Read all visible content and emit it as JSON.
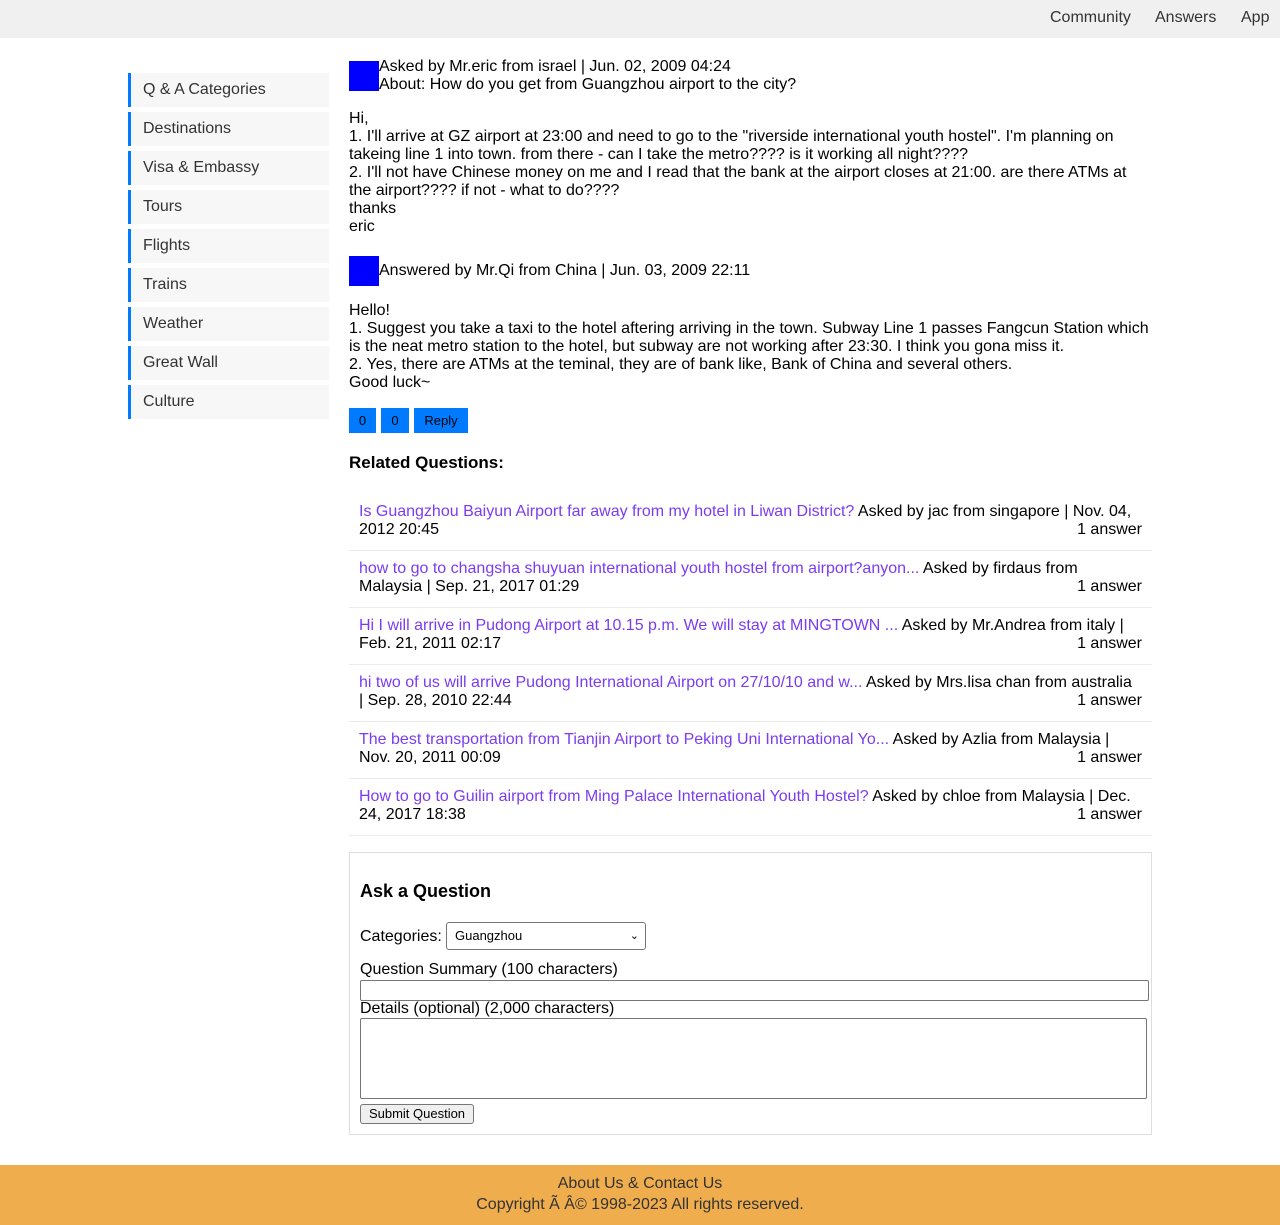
{
  "nav": {
    "community": "Community",
    "answers": "Answers",
    "app": "App"
  },
  "sidebar": {
    "items": [
      {
        "label": "Q & A Categories"
      },
      {
        "label": "Destinations"
      },
      {
        "label": "Visa & Embassy"
      },
      {
        "label": "Tours"
      },
      {
        "label": "Flights"
      },
      {
        "label": "Trains"
      },
      {
        "label": "Weather"
      },
      {
        "label": "Great Wall"
      },
      {
        "label": "Culture"
      }
    ]
  },
  "question": {
    "meta": "Asked by Mr.eric from israel | Jun. 02, 2009 04:24",
    "about": "About: How do you get from Guangzhou airport to the city?",
    "body": [
      "Hi,",
      "1. I'll arrive at GZ airport at 23:00 and need to go to the \"riverside international youth hostel\". I'm planning on takeing line 1 into town. from there - can I take the metro???? is it working all night????",
      "2. I'll not have Chinese money on me and I read that the bank at the airport closes at 21:00. are there ATMs at the airport???? if not - what to do????",
      "thanks",
      "eric"
    ]
  },
  "answer": {
    "meta": "Answered by Mr.Qi from China | Jun. 03, 2009 22:11",
    "body": [
      "Hello!",
      "1. Suggest you take a taxi to the hotel aftering arriving in the town. Subway Line 1 passes Fangcun Station which is the neat metro station to the hotel, but subway are not working after 23:30. I think you gona miss it.",
      "2. Yes, there are ATMs at the teminal, they are of bank like, Bank of China and several others.",
      "Good luck~"
    ],
    "upvotes": "0",
    "downvotes": "0",
    "reply_label": "Reply"
  },
  "related": {
    "title": "Related Questions:",
    "items": [
      {
        "link": "Is Guangzhou Baiyun Airport far away from my hotel in Liwan District?",
        "meta": " Asked by jac from singapore | Nov. 04, 2012 20:45",
        "count": "1 answer"
      },
      {
        "link": "how to go to changsha shuyuan international youth hostel from airport?anyon...",
        "meta": " Asked by firdaus from Malaysia | Sep. 21, 2017 01:29",
        "count": "1 answer"
      },
      {
        "link": "Hi I will arrive in Pudong Airport at 10.15 p.m. We will stay at MINGTOWN ...",
        "meta": " Asked by Mr.Andrea from italy | Feb. 21, 2011 02:17",
        "count": "1 answer"
      },
      {
        "link": "hi two of us will arrive Pudong International Airport on 27/10/10 and w...",
        "meta": " Asked by Mrs.lisa chan from australia | Sep. 28, 2010 22:44",
        "count": "1 answer"
      },
      {
        "link": "The best transportation from Tianjin Airport to Peking Uni International Yo...",
        "meta": " Asked by Azlia from Malaysia | Nov. 20, 2011 00:09",
        "count": "1 answer"
      },
      {
        "link": "How to go to Guilin airport from Ming Palace International Youth Hostel?",
        "meta": " Asked by chloe from Malaysia | Dec. 24, 2017 18:38",
        "count": "1 answer"
      }
    ]
  },
  "ask": {
    "title": "Ask a Question",
    "categories_label": "Categories:",
    "categories_value": "Guangzhou",
    "summary_label": "Question Summary (100 characters)",
    "details_label": "Details (optional) (2,000 characters)",
    "submit_label": "Submit Question"
  },
  "footer": {
    "links": "About Us & Contact Us",
    "copyright": "Copyright Ã    Â© 1998-2023 All rights reserved."
  },
  "colors": {
    "accent": "#007bff",
    "avatar": "#0000ff",
    "link": "#7b3cf0",
    "footer_bg": "#efad4d",
    "topnav_bg": "#f0f0f0"
  }
}
